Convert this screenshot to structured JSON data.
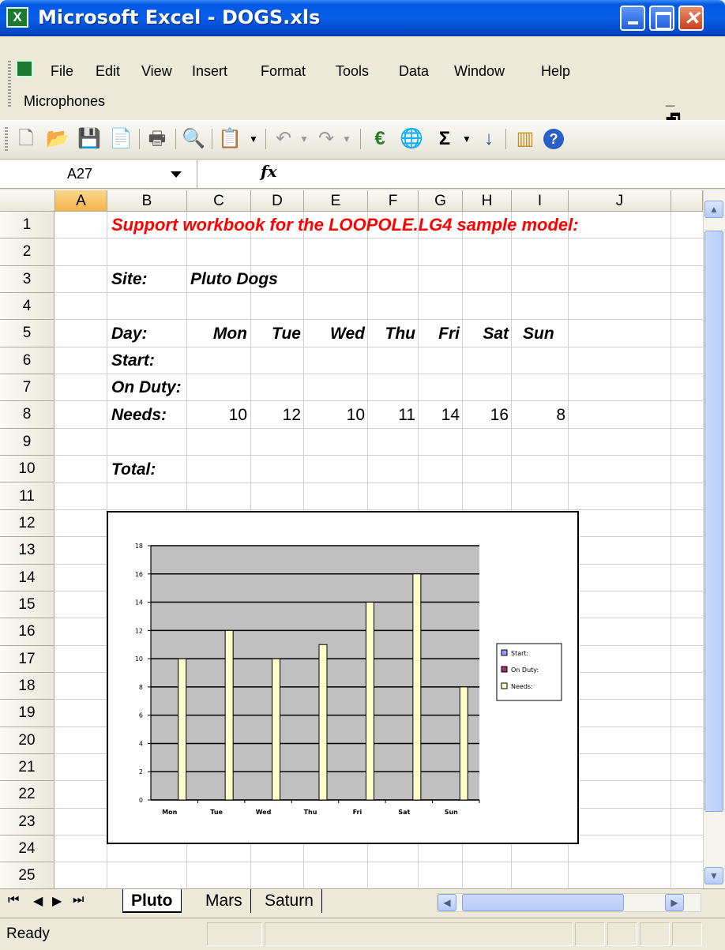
{
  "window": {
    "title": "Microsoft Excel - DOGS.xls",
    "app_icon": "excel-icon",
    "controls": [
      "minimize-icon",
      "maximize-icon",
      "close-icon"
    ]
  },
  "menu": {
    "items": [
      "File",
      "Edit",
      "View",
      "Insert",
      "Format",
      "Tools",
      "Data",
      "Window",
      "Help"
    ],
    "document_name": "Microphones",
    "doc_controls": "_ 🗗 ×"
  },
  "toolbar": {
    "icons": [
      "new-icon",
      "open-icon",
      "save-icon",
      "permission-icon",
      "print-icon",
      "research-icon",
      "paste-icon",
      "undo-icon",
      "redo-icon",
      "euro-icon",
      "hyperlink-icon",
      "autosum-icon",
      "sort-ascending-icon",
      "chart-wizard-icon",
      "help-icon"
    ],
    "glyphs": [
      "🗋",
      "📂",
      "💾",
      "📄",
      "🖶",
      "🔍",
      "📋",
      "↶",
      "↷",
      "€",
      "🌐",
      "Σ",
      "↓",
      "▥",
      "?"
    ]
  },
  "formula_bar": {
    "name_box": "A27",
    "fx": "fx",
    "content": ""
  },
  "columns": [
    "A",
    "B",
    "C",
    "D",
    "E",
    "F",
    "G",
    "H",
    "I",
    "J"
  ],
  "selected_column": "A",
  "rows": [
    "1",
    "2",
    "3",
    "4",
    "5",
    "6",
    "7",
    "8",
    "9",
    "10",
    "11",
    "12",
    "13",
    "14",
    "15",
    "16",
    "17",
    "18",
    "19",
    "20",
    "21",
    "22",
    "23",
    "24",
    "25"
  ],
  "cells": {
    "B1": "Support workbook for the LOOPOLE.LG4 sample model:",
    "B3": "Site:",
    "C3": "Pluto Dogs",
    "B5": "Day:",
    "days": [
      "Mon",
      "Tue",
      "Wed",
      "Thu",
      "Fri",
      "Sat",
      "Sun"
    ],
    "B6": "Start:",
    "B7": "On Duty:",
    "B8": "Needs:",
    "needs": [
      "10",
      "12",
      "10",
      "11",
      "14",
      "16",
      "8"
    ],
    "B10": "Total:"
  },
  "colors": {
    "title_red": "#ff0000",
    "bar_fill": "#ffffcc",
    "plot_bg": "#c0c0c0",
    "legend_start": "#9999ff",
    "legend_onduty": "#993366",
    "legend_needs": "#ffffcc"
  },
  "chart_data": {
    "type": "bar",
    "categories": [
      "Mon",
      "Tue",
      "Wed",
      "Thu",
      "Fri",
      "Sat",
      "Sun"
    ],
    "series": [
      {
        "name": "Start:",
        "values": [
          null,
          null,
          null,
          null,
          null,
          null,
          null
        ]
      },
      {
        "name": "On Duty:",
        "values": [
          null,
          null,
          null,
          null,
          null,
          null,
          null
        ]
      },
      {
        "name": "Needs:",
        "values": [
          10,
          12,
          10,
          11,
          14,
          16,
          8
        ]
      }
    ],
    "yticks": [
      "0",
      "2",
      "4",
      "6",
      "8",
      "10",
      "12",
      "14",
      "16",
      "18"
    ],
    "ylim": [
      0,
      18
    ],
    "grid": true,
    "legend": "right"
  },
  "sheet_tabs": [
    "Pluto",
    "Mars",
    "Saturn"
  ],
  "active_tab": "Pluto",
  "tab_nav": [
    "first-sheet-icon",
    "prev-sheet-icon",
    "next-sheet-icon",
    "last-sheet-icon"
  ],
  "status": "Ready"
}
